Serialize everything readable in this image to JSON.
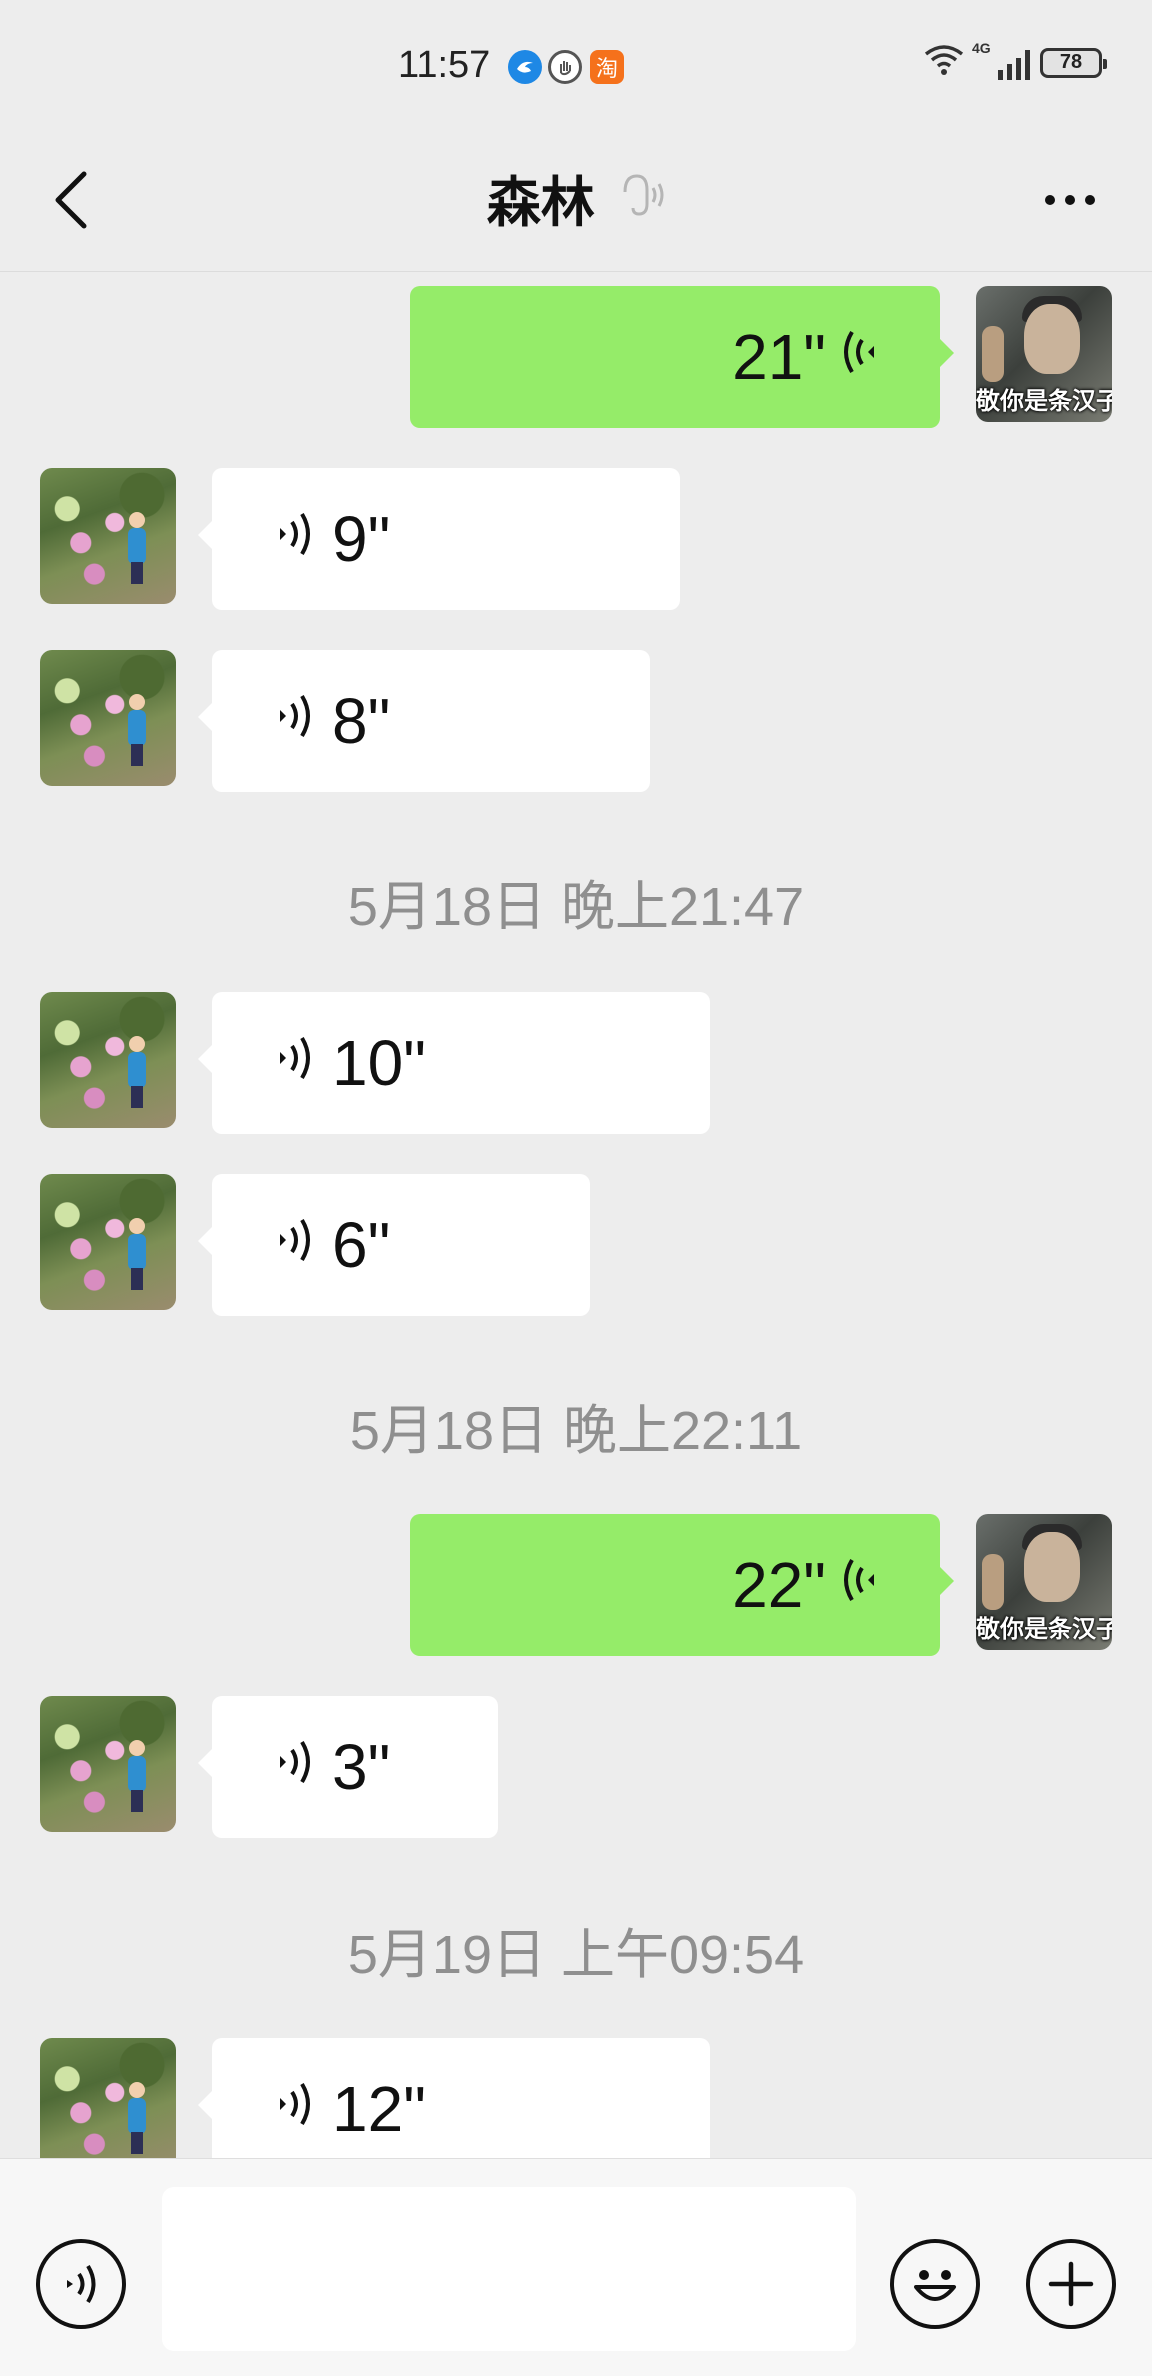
{
  "status_bar": {
    "time": "11:57",
    "app_icons": [
      {
        "name": "browser-icon",
        "label": "",
        "color": "#1e88e5"
      },
      {
        "name": "hand-icon",
        "label": "",
        "color": "#555555"
      },
      {
        "name": "taobao-icon",
        "label": "淘",
        "color": "#f5711b"
      }
    ],
    "network": "4G",
    "battery": "78"
  },
  "header": {
    "title": "森林",
    "muted": true
  },
  "messages": [
    {
      "type": "voice",
      "direction": "out",
      "duration": "21\"",
      "avatar_caption": "敬你是条汉子"
    },
    {
      "type": "voice",
      "direction": "in",
      "duration": "9\""
    },
    {
      "type": "voice",
      "direction": "in",
      "duration": "8\""
    },
    {
      "type": "timestamp",
      "text": "5月18日 晚上21:47"
    },
    {
      "type": "voice",
      "direction": "in",
      "duration": "10\""
    },
    {
      "type": "voice",
      "direction": "in",
      "duration": "6\""
    },
    {
      "type": "timestamp",
      "text": "5月18日 晚上22:11"
    },
    {
      "type": "voice",
      "direction": "out",
      "duration": "22\"",
      "avatar_caption": "敬你是条汉子"
    },
    {
      "type": "voice",
      "direction": "in",
      "duration": "3\""
    },
    {
      "type": "timestamp",
      "text": "5月19日 上午09:54"
    },
    {
      "type": "voice",
      "direction": "in",
      "duration": "12\""
    }
  ],
  "input_bar": {
    "text_value": "",
    "icons": [
      "voice-mode-icon",
      "emoji-icon",
      "plus-icon"
    ]
  },
  "colors": {
    "background": "#ededed",
    "outgoing_bubble": "#95ec69",
    "incoming_bubble": "#ffffff",
    "timestamp_text": "#8f8f8f"
  }
}
